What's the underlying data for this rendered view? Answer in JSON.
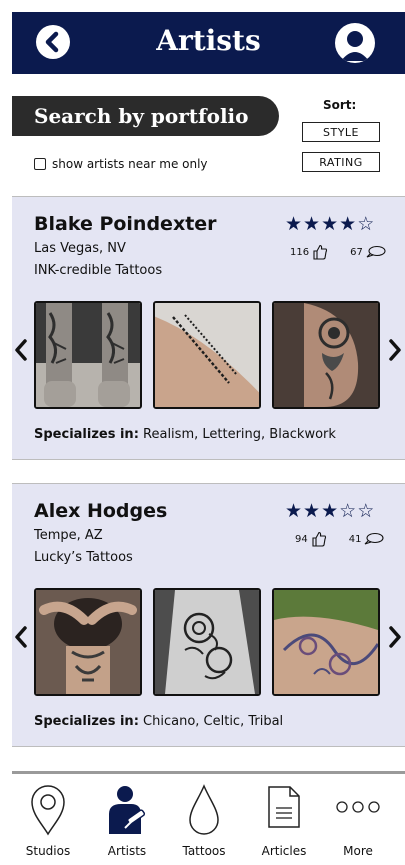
{
  "header": {
    "title": "Artists"
  },
  "search": {
    "label": "Search by portfolio",
    "near_me_label": "show artists near me only",
    "sort_label": "Sort:",
    "sort_options": [
      "STYLE",
      "RATING"
    ]
  },
  "artists": [
    {
      "name": "Blake Poindexter",
      "location": "Las Vegas, NV",
      "shop": "INK-credible Tattoos",
      "rating": 4,
      "max_rating": 5,
      "likes": "116",
      "comments": "67",
      "specializes_label": "Specializes in:",
      "specialties": "Realism, Lettering, Blackwork"
    },
    {
      "name": "Alex Hodges",
      "location": "Tempe, AZ",
      "shop": "Lucky’s Tattoos",
      "rating": 3,
      "max_rating": 5,
      "likes": "94",
      "comments": "41",
      "specializes_label": "Specializes in:",
      "specialties": "Chicano, Celtic, Tribal"
    }
  ],
  "nav": [
    {
      "label": "Studios",
      "icon": "map-pin-icon"
    },
    {
      "label": "Artists",
      "icon": "tattoo-artist-icon"
    },
    {
      "label": "Tattoos",
      "icon": "ink-drop-icon"
    },
    {
      "label": "Articles",
      "icon": "document-icon"
    },
    {
      "label": "More",
      "icon": "more-dots-icon"
    }
  ],
  "colors": {
    "header": "#0b1a4e",
    "card": "#e4e5f3",
    "pill": "#2b2b2b",
    "star": "#0b1a4e"
  }
}
